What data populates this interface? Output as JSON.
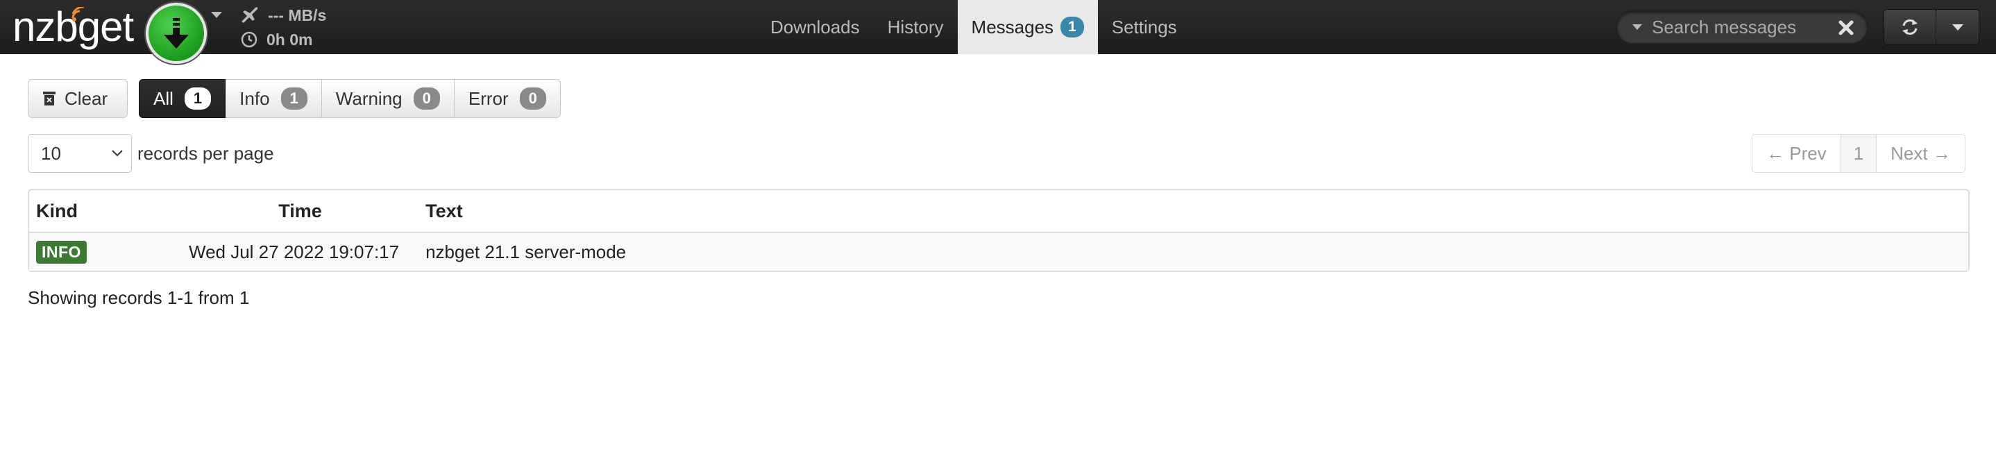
{
  "app": {
    "brand": {
      "prefix": "nz",
      "b": "b",
      "suffix": "get"
    },
    "status": {
      "speed": "--- MB/s",
      "time_left": "0h 0m"
    }
  },
  "nav": {
    "items": [
      {
        "label": "Downloads"
      },
      {
        "label": "History"
      },
      {
        "label": "Messages",
        "badge": "1",
        "active": true
      },
      {
        "label": "Settings"
      }
    ]
  },
  "search": {
    "placeholder": "Search messages",
    "value": ""
  },
  "toolbar": {
    "clear_label": "Clear",
    "filters": [
      {
        "label": "All",
        "count": "1",
        "active": true
      },
      {
        "label": "Info",
        "count": "1"
      },
      {
        "label": "Warning",
        "count": "0"
      },
      {
        "label": "Error",
        "count": "0"
      }
    ]
  },
  "per_page": {
    "value": "10",
    "label": "records per page"
  },
  "pager": {
    "prev": "← Prev",
    "current": "1",
    "next": "Next →"
  },
  "table": {
    "headers": {
      "kind": "Kind",
      "time": "Time",
      "text": "Text"
    },
    "rows": [
      {
        "kind": "INFO",
        "time": "Wed Jul 27 2022 19:07:17",
        "text": "nzbget 21.1 server-mode"
      }
    ]
  },
  "footer": {
    "info": "Showing records 1-1 from 1"
  },
  "colors": {
    "navbar_bg": "#1d1d1d",
    "accent_badge": "#3a87ad",
    "info_label": "#3b7a33",
    "brand_orange": "#f28c28",
    "play_green": "#1a9a1a"
  },
  "icons": {
    "brand_wave": "wifi-wave-icon",
    "play": "download-arrow-icon",
    "speed": "plane-icon",
    "time": "clock-icon",
    "search_clear": "close-icon",
    "refresh": "refresh-icon",
    "clear": "trash-icon"
  }
}
